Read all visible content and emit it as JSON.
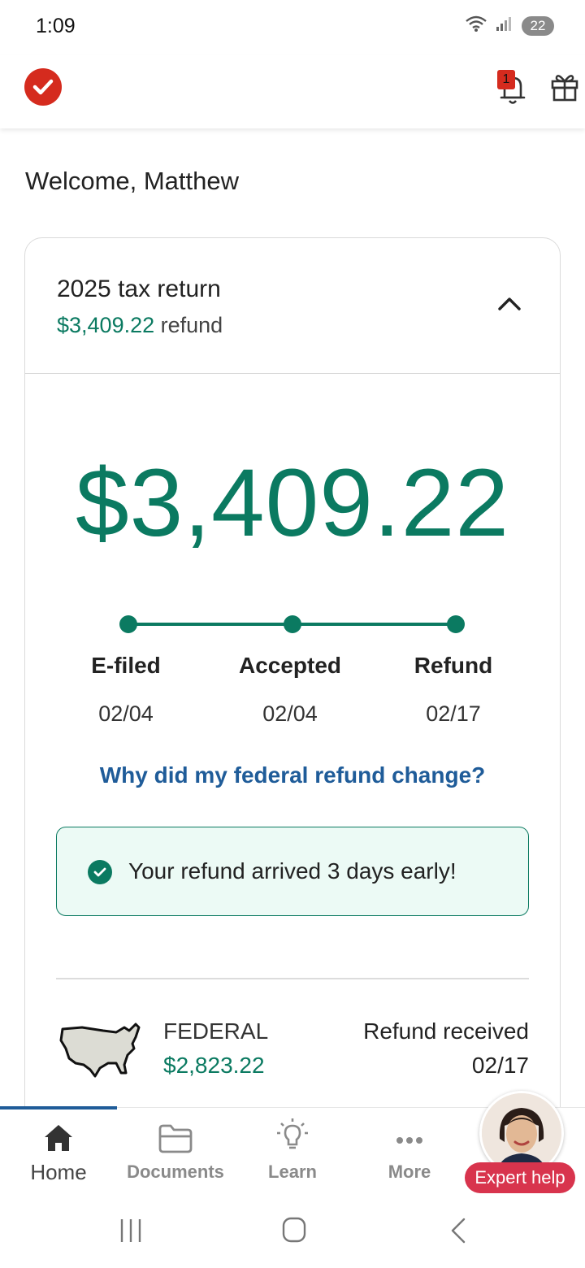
{
  "status_bar": {
    "time": "1:09",
    "battery": "22"
  },
  "header": {
    "notification_count": "1"
  },
  "welcome": "Welcome, Matthew",
  "card": {
    "title": "2025 tax return",
    "refund_amount": "$3,409.22",
    "refund_word": "refund",
    "big_amount": "$3,409.22",
    "progress_percent": 100,
    "steps": [
      {
        "label": "E-filed",
        "date": "02/04"
      },
      {
        "label": "Accepted",
        "date": "02/04"
      },
      {
        "label": "Refund",
        "date": "02/17"
      }
    ],
    "link": "Why did my federal refund change?",
    "success_message": "Your refund arrived 3 days early!",
    "federal": {
      "label": "FEDERAL",
      "amount": "$2,823.22",
      "status": "Refund received",
      "date": "02/17"
    }
  },
  "bottom_nav": {
    "items": [
      {
        "label": "Home",
        "icon": "home-icon"
      },
      {
        "label": "Documents",
        "icon": "folder-icon"
      },
      {
        "label": "Learn",
        "icon": "lightbulb-icon"
      },
      {
        "label": "More",
        "icon": "more-dots-icon"
      }
    ],
    "expert_label": "Expert help"
  },
  "colors": {
    "brand_green": "#0b7a61",
    "brand_red": "#d52b1e",
    "link_blue": "#1f5c99",
    "expert_pink": "#d8344d"
  }
}
